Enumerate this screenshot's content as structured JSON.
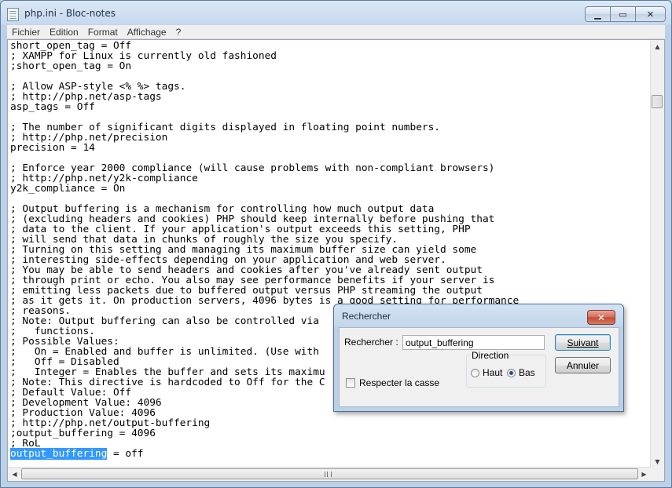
{
  "window": {
    "title": "php.ini - Bloc-notes",
    "caption_buttons": {
      "minimize": "▁",
      "maximize": "▭",
      "close": "✕"
    }
  },
  "menu": [
    "Fichier",
    "Edition",
    "Format",
    "Affichage",
    "?"
  ],
  "editor": {
    "lines": [
      "short_open_tag = Off",
      "; XAMPP for Linux is currently old fashioned",
      ";short_open_tag = On",
      "",
      "; Allow ASP-style <% %> tags.",
      "; http://php.net/asp-tags",
      "asp_tags = Off",
      "",
      "; The number of significant digits displayed in floating point numbers.",
      "; http://php.net/precision",
      "precision = 14",
      "",
      "; Enforce year 2000 compliance (will cause problems with non-compliant browsers)",
      "; http://php.net/y2k-compliance",
      "y2k_compliance = On",
      "",
      "; Output buffering is a mechanism for controlling how much output data",
      "; (excluding headers and cookies) PHP should keep internally before pushing that",
      "; data to the client. If your application's output exceeds this setting, PHP",
      "; will send that data in chunks of roughly the size you specify.",
      "; Turning on this setting and managing its maximum buffer size can yield some",
      "; interesting side-effects depending on your application and web server.",
      "; You may be able to send headers and cookies after you've already sent output",
      "; through print or echo. You also may see performance benefits if your server is",
      "; emitting less packets due to buffered output versus PHP streaming the output",
      "; as it gets it. On production servers, 4096 bytes is a good setting for performance",
      "; reasons.",
      "; Note: Output buffering can also be controlled via",
      ";   functions.",
      "; Possible Values:",
      ";   On = Enabled and buffer is unlimited. (Use with",
      ";   Off = Disabled",
      ";   Integer = Enables the buffer and sets its maximu",
      "; Note: This directive is hardcoded to Off for the C",
      "; Default Value: Off",
      "; Development Value: 4096",
      "; Production Value: 4096",
      "; http://php.net/output-buffering",
      ";output_buffering = 4096",
      "; RoL"
    ],
    "last_line_selected": "output_buffering",
    "last_line_rest": " = off"
  },
  "find_dialog": {
    "title": "Rechercher",
    "search_label": "Rechercher :",
    "search_value": "output_buffering",
    "next_button": "Suivant",
    "cancel_button": "Annuler",
    "match_case_label": "Respecter la casse",
    "match_case_checked": false,
    "direction_label": "Direction",
    "direction_up": "Haut",
    "direction_down": "Bas",
    "direction_selected": "Bas",
    "close_glyph": "✕"
  }
}
